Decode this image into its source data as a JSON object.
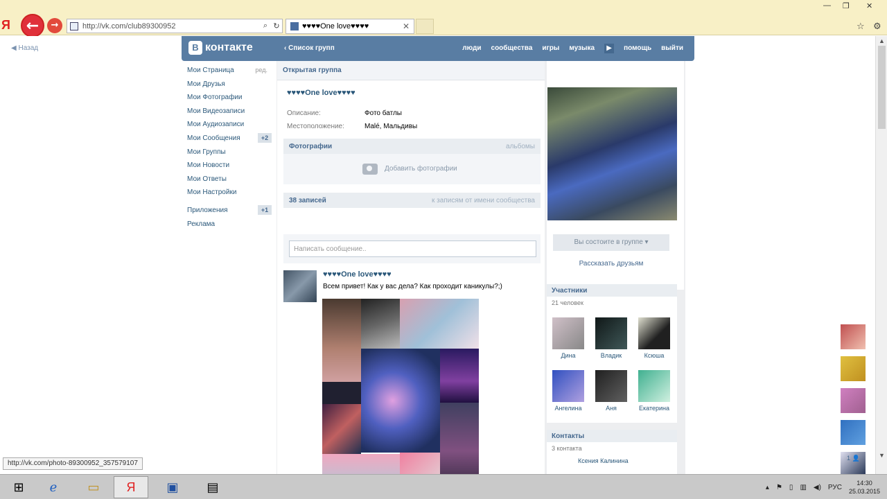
{
  "browser": {
    "logo": "Я",
    "address_url": "http://vk.com/club89300952",
    "tab_title": "♥♥♥♥One love♥♥♥♥",
    "tab_close": "✕",
    "win_min": "—",
    "win_max": "❐",
    "win_close": "✕"
  },
  "vk": {
    "back_label": "Назад",
    "logo_text": "контакте",
    "logo_b": "В",
    "groups_link": "Список групп",
    "nav": [
      "люди",
      "сообщества",
      "игры",
      "музыка",
      "помощь",
      "выйти"
    ],
    "nav_more": "▶"
  },
  "left_menu": {
    "items": [
      {
        "label": "Мои Страница",
        "right": "ред."
      },
      {
        "label": "Мои Друзья"
      },
      {
        "label": "Мои Фотографии"
      },
      {
        "label": "Мои Видеозаписи"
      },
      {
        "label": "Мои Аудиозаписи"
      },
      {
        "label": "Мои Сообщения",
        "badge": "+2"
      },
      {
        "label": "Мои Группы"
      },
      {
        "label": "Мои Новости"
      },
      {
        "label": "Мои Ответы"
      },
      {
        "label": "Мои Настройки"
      }
    ],
    "apps": {
      "label": "Приложения",
      "badge": "+1"
    },
    "ads": "Реклама"
  },
  "group": {
    "type": "Открытая группа",
    "name": "♥♥♥♥One love♥♥♥♥",
    "description_label": "Описание:",
    "description_value": "Фото батлы",
    "location_label": "Местоположение:",
    "location_value": "Malé, Мальдивы"
  },
  "photos": {
    "header": "Фотографии",
    "albums": "альбомы",
    "add": "Добавить фотографии"
  },
  "wall": {
    "header": "38 записей",
    "right": "к записям от имени сообщества",
    "input_placeholder": "Написать сообщение..",
    "post_author": "♥♥♥♥One love♥♥♥♥",
    "post_text": "Всем привет! Как у вас дела? Как проходит каникулы?;)"
  },
  "side": {
    "member_btn": "Вы состоите в группе ▾",
    "tell_friends": "Рассказать друзьям",
    "members_header": "Участники",
    "members_count": "21 человек",
    "members": [
      "Дина",
      "Владик",
      "Ксюша",
      "Ангелина",
      "Аня",
      "Екатерина"
    ],
    "contacts_header": "Контакты",
    "contacts_count": "3 контакта",
    "contact_name": "Ксения Калинина"
  },
  "status_bar_url": "http://vk.com/photo-89300952_357579107",
  "right_bar_count": "1 👤",
  "taskbar": {
    "lang": "РУС",
    "time": "14:30",
    "date": "25.03.2015"
  },
  "colors": {
    "vk_blue": "#597da3",
    "browser_bg": "#f8f0c6",
    "taskbar": "#c9c9c9"
  }
}
